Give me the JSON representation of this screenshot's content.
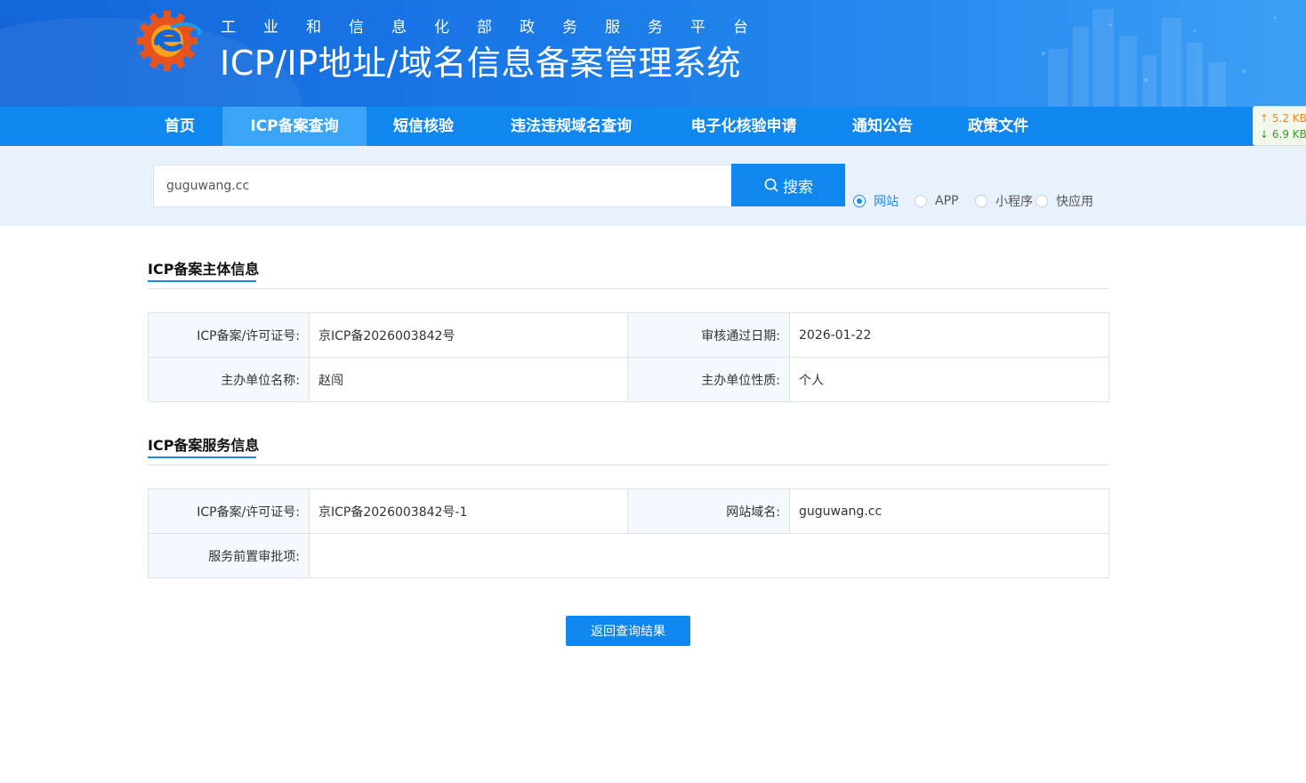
{
  "header": {
    "subtitle": "工业和信息化部政务服务平台",
    "title": "ICP/IP地址/域名信息备案管理系统"
  },
  "nav": {
    "items": [
      {
        "label": "首页",
        "active": false
      },
      {
        "label": "ICP备案查询",
        "active": true
      },
      {
        "label": "短信核验",
        "active": false
      },
      {
        "label": "违法违规域名查询",
        "active": false
      },
      {
        "label": "电子化核验申请",
        "active": false
      },
      {
        "label": "通知公告",
        "active": false
      },
      {
        "label": "政策文件",
        "active": false
      }
    ]
  },
  "speed_widget": {
    "up": "↑ 5.2 KB/",
    "down": "↓ 6.9 KB/"
  },
  "search": {
    "value": "guguwang.cc",
    "button_label": "搜索",
    "types": [
      {
        "label": "网站",
        "selected": true
      },
      {
        "label": "APP",
        "selected": false
      },
      {
        "label": "小程序",
        "selected": false
      },
      {
        "label": "快应用",
        "selected": false
      }
    ]
  },
  "subject_info": {
    "title": "ICP备案主体信息",
    "license_label": "ICP备案/许可证号:",
    "license_value": "京ICP备2026003842号",
    "approve_date_label": "审核通过日期:",
    "approve_date_value": "2026-01-22",
    "org_name_label": "主办单位名称:",
    "org_name_value": "赵闯",
    "org_type_label": "主办单位性质:",
    "org_type_value": "个人"
  },
  "service_info": {
    "title": "ICP备案服务信息",
    "license_label": "ICP备案/许可证号:",
    "license_value": "京ICP备2026003842号-1",
    "domain_label": "网站域名:",
    "domain_value": "guguwang.cc",
    "pre_approval_label": "服务前置审批项:",
    "pre_approval_value": ""
  },
  "actions": {
    "back_label": "返回查询结果"
  },
  "colors": {
    "primary": "#0f87ee",
    "nav_active": "#3aa4f7",
    "search_band": "#e8f2fc",
    "key_cell": "#f5f9fd"
  }
}
